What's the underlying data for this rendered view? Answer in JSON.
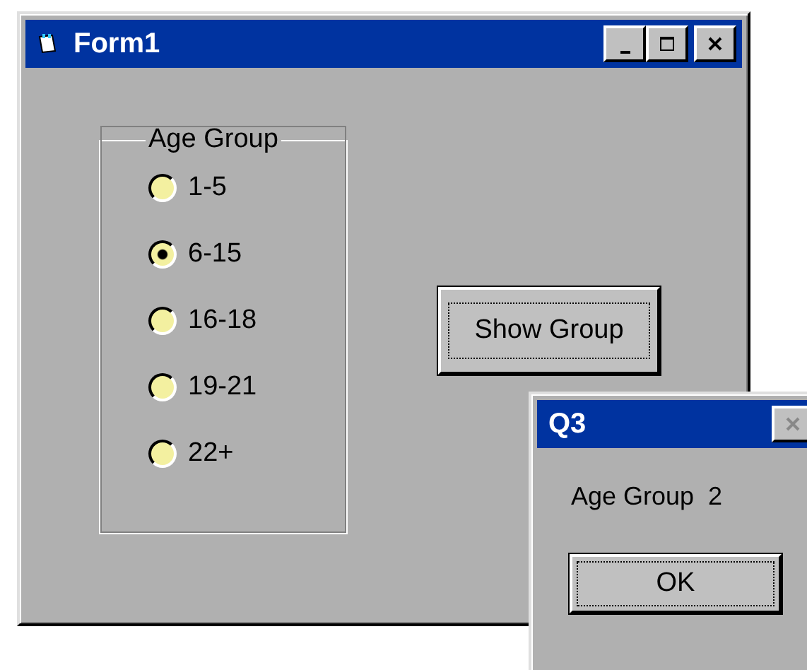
{
  "main_window": {
    "title": "Form1",
    "group": {
      "label": "Age Group",
      "options": [
        {
          "label": "1-5",
          "selected": false
        },
        {
          "label": "6-15",
          "selected": true
        },
        {
          "label": "16-18",
          "selected": false
        },
        {
          "label": "19-21",
          "selected": false
        },
        {
          "label": "22+",
          "selected": false
        }
      ]
    },
    "button": "Show Group"
  },
  "dialog": {
    "title": "Q3",
    "message": "Age Group  2",
    "button": "OK"
  }
}
